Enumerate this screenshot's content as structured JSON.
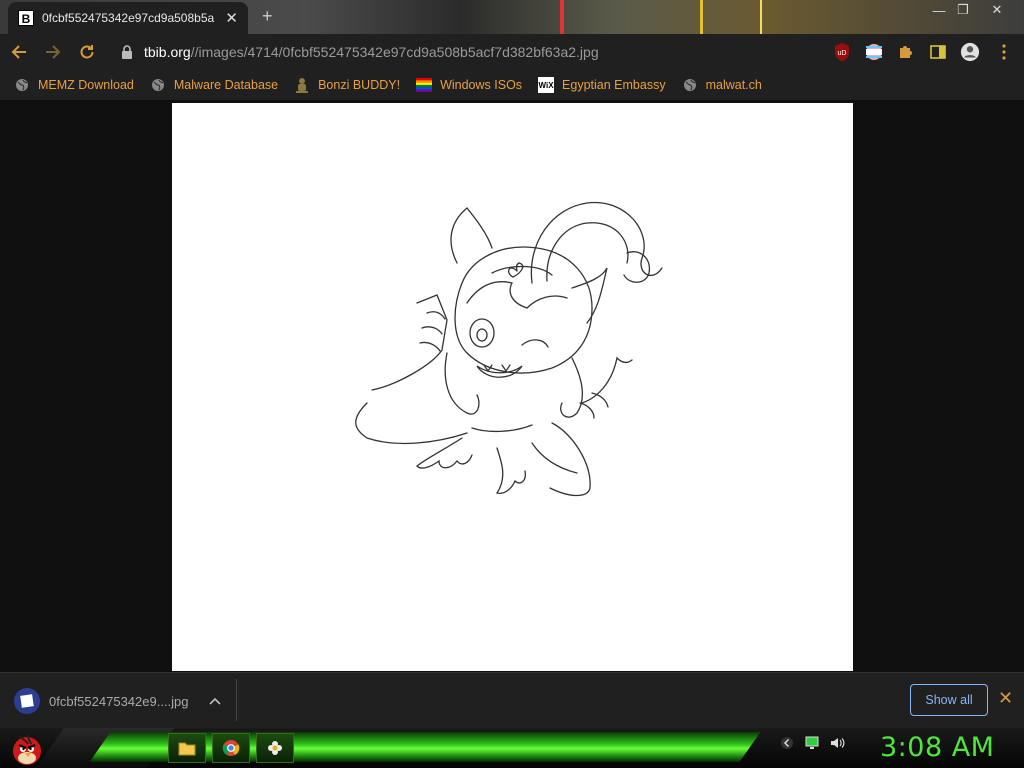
{
  "tab": {
    "title": "0fcbf552475342e97cd9a508b5a",
    "favicon_letter": "B",
    "close": "✕",
    "new_tab": "+"
  },
  "window_controls": {
    "minimize": "—",
    "restore": "❐",
    "close": "✕"
  },
  "address": {
    "host": "tbib.org",
    "path": "//images/4714/0fcbf552475342e97cd9a508b5acf7d382bf63a2.jpg"
  },
  "bookmarks": [
    {
      "label": "MEMZ Download",
      "icon": "globe-icon"
    },
    {
      "label": "Malware Database",
      "icon": "globe-icon"
    },
    {
      "label": "Bonzi BUDDY!",
      "icon": "bonzi-icon"
    },
    {
      "label": "Windows ISOs",
      "icon": "rainbow-flag-icon"
    },
    {
      "label": "Egyptian Embassy",
      "icon": "wix-icon"
    },
    {
      "label": "malwat.ch",
      "icon": "globe-icon"
    }
  ],
  "bookmark_wix_text": "WiX",
  "extensions": {
    "ublock_text": "uD"
  },
  "download": {
    "filename": "0fcbf552475342e9....jpg",
    "show_all": "Show all",
    "close": "✕"
  },
  "taskbar": {
    "clock": "3:08 AM"
  },
  "colors": {
    "accent": "#d79b3d",
    "bookmark_text": "#e8a040",
    "link_blue": "#8ab4f8",
    "clock_green": "#4fe63a"
  }
}
